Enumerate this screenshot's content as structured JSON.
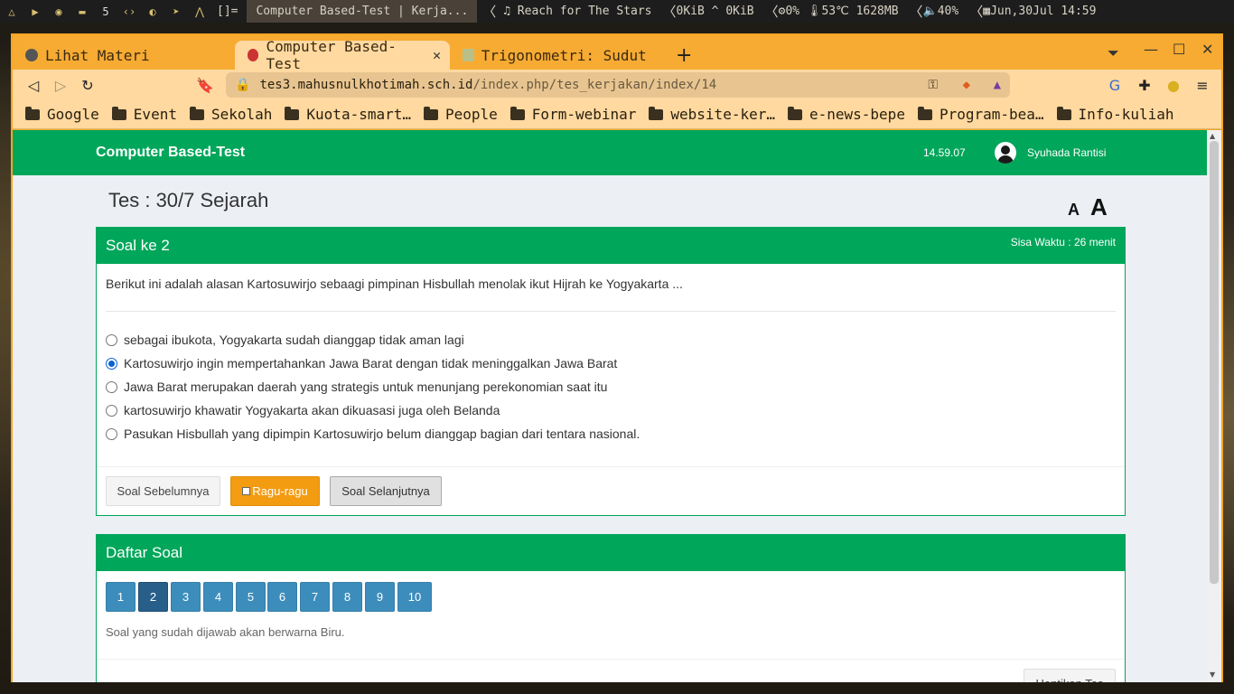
{
  "sysbar": {
    "workspace_num": "5",
    "bracket": "[]=",
    "window_title": "Computer Based-Test | Kerja...",
    "music": "Reach for The Stars",
    "net": "0KiB ^ 0KiB",
    "cpu": "0%",
    "temp": "53℃",
    "mem": "1628MB",
    "volume": "40%",
    "datetime": "Jun,30Jul 14:59"
  },
  "browser": {
    "tabs": [
      {
        "label": "Lihat Materi",
        "favicon_color": "#555555"
      },
      {
        "label": "Computer Based-Test",
        "favicon_color": "#cc3333"
      },
      {
        "label": "Trigonometri: Sudut Is",
        "favicon_color": "#b8c08a"
      }
    ],
    "new_tab": "+",
    "url_host": "tes3.mahusnulkhotimah.sch.id",
    "url_path": "/index.php/tes_kerjakan/index/14",
    "bookmarks": [
      "Google",
      "Event",
      "Sekolah",
      "Kuota-smart…",
      "People",
      "Form-webinar",
      "website-ker…",
      "e-news-bepe",
      "Program-bea…",
      "Info-kuliah"
    ]
  },
  "app": {
    "brand": "Computer Based-Test",
    "clock": "14.59.07",
    "user": "Syuhada Rantisi"
  },
  "test": {
    "title": "Tes : 30/7 Sejarah",
    "font_small": "A",
    "font_large": "A",
    "question_label": "Soal ke 2",
    "time_left": "Sisa Waktu : 26 menit",
    "question": "Berikut ini adalah alasan Kartosuwirjo sebaagi pimpinan Hisbullah menolak ikut Hijrah ke Yogyakarta ...",
    "options": [
      {
        "text": "sebagai ibukota, Yogyakarta sudah dianggap tidak aman lagi",
        "selected": false
      },
      {
        "text": "Kartosuwirjo ingin mempertahankan Jawa Barat dengan tidak meninggalkan Jawa Barat",
        "selected": true
      },
      {
        "text": "Jawa Barat merupakan daerah yang strategis untuk menunjang perekonomian saat itu",
        "selected": false
      },
      {
        "text": "kartosuwirjo khawatir Yogyakarta akan dikuasasi juga oleh Belanda",
        "selected": false
      },
      {
        "text": "Pasukan Hisbullah yang dipimpin Kartosuwirjo belum dianggap bagian dari tentara nasional.",
        "selected": false
      }
    ],
    "prev_label": "Soal Sebelumnya",
    "doubt_label": "Ragu-ragu",
    "next_label": "Soal Selanjutnya"
  },
  "list": {
    "title": "Daftar Soal",
    "numbers": [
      "1",
      "2",
      "3",
      "4",
      "5",
      "6",
      "7",
      "8",
      "9",
      "10"
    ],
    "current": "2",
    "note": "Soal yang sudah dijawab akan berwarna Biru.",
    "stop_label": "Hentikan Tes"
  }
}
